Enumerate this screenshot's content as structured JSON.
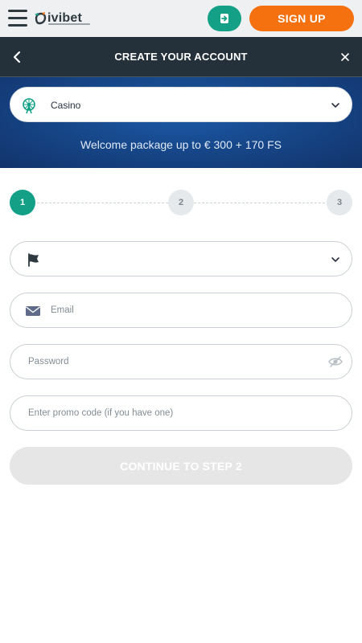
{
  "header": {
    "logo_text": "ivibet",
    "signup_label": "SIGN UP"
  },
  "titlebar": {
    "title": "CREATE YOUR ACCOUNT"
  },
  "banner": {
    "product_selected": "Casino",
    "welcome_text": "Welcome package up to € 300 + 170 FS"
  },
  "steps": [
    {
      "label": "1",
      "active": true
    },
    {
      "label": "2",
      "active": false
    },
    {
      "label": "3",
      "active": false
    }
  ],
  "form": {
    "country_value": "",
    "email_placeholder": "Email",
    "password_placeholder": "Password",
    "promo_placeholder": "Enter promo code (if you have one)",
    "continue_label": "CONTINUE TO STEP 2"
  },
  "colors": {
    "accent_green": "#13a086",
    "accent_orange": "#f5700f",
    "titlebar_bg": "#25313a",
    "banner_blue": "#174a8e",
    "disabled_button": "#e6e6e6"
  },
  "icons": {
    "menu": "hamburger-icon",
    "login": "login-icon",
    "back": "chevron-left-icon",
    "close": "close-icon",
    "product": "ferris-wheel-icon",
    "country": "flag-icon",
    "email": "envelope-icon",
    "password_toggle": "eye-slash-icon"
  }
}
